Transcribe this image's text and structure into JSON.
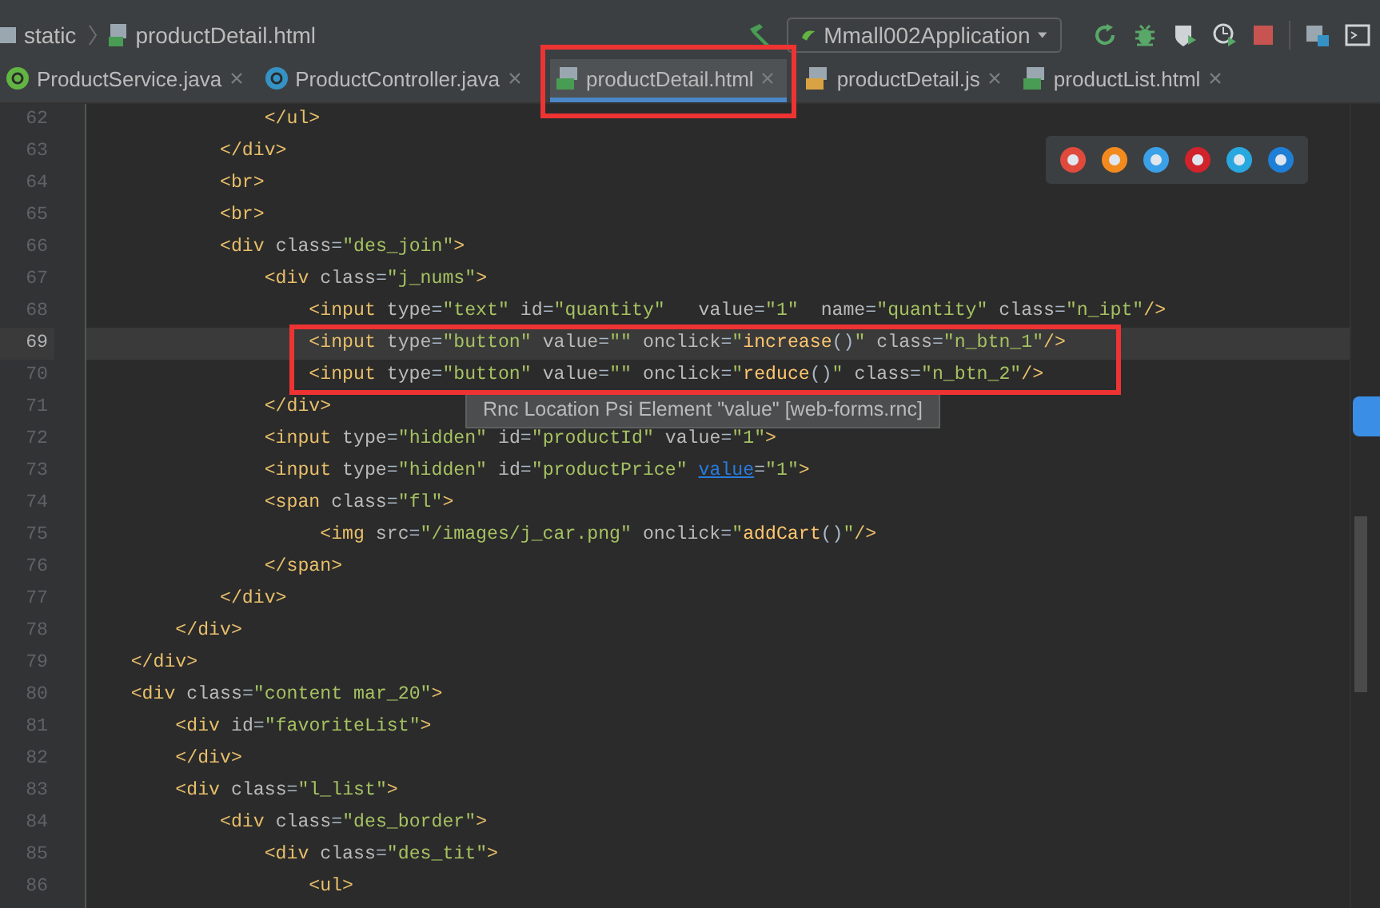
{
  "breadcrumb": [
    {
      "label": "static",
      "kind": "folder"
    },
    {
      "label": "productDetail.html",
      "kind": "html"
    }
  ],
  "run_configuration": {
    "label": "Mmall002Application"
  },
  "tabs": [
    {
      "label": "ProductService.java",
      "kind": "interface",
      "selected": false
    },
    {
      "label": "ProductController.java",
      "kind": "class",
      "selected": false
    },
    {
      "label": "productDetail.html",
      "kind": "html",
      "selected": true
    },
    {
      "label": "productDetail.js",
      "kind": "js",
      "selected": false
    },
    {
      "label": "productList.html",
      "kind": "html",
      "selected": false
    }
  ],
  "editor": {
    "lines": [
      {
        "number": "62",
        "current": false,
        "parts": [
          {
            "kind": "code",
            "text": "                </ul>"
          }
        ]
      },
      {
        "number": "63",
        "current": false,
        "parts": [
          {
            "kind": "code",
            "text": "            </div>"
          }
        ]
      },
      {
        "number": "64",
        "current": false,
        "parts": [
          {
            "kind": "code",
            "text": "            <br>"
          }
        ]
      },
      {
        "number": "65",
        "current": false,
        "parts": [
          {
            "kind": "code",
            "text": "            <br>"
          }
        ]
      },
      {
        "number": "66",
        "current": false,
        "parts": [
          {
            "kind": "code",
            "text": "            <div class=\"des_join\">"
          }
        ]
      },
      {
        "number": "67",
        "current": false,
        "parts": [
          {
            "kind": "code",
            "text": "                <div class=\"j_nums\">"
          }
        ]
      },
      {
        "number": "68",
        "current": false,
        "parts": [
          {
            "kind": "code",
            "text": "                    <input type=\"text\" id=\"quantity\"   value=\"1\"  name=\"quantity\" class=\"n_ipt\"/>"
          }
        ]
      },
      {
        "number": "69",
        "current": true,
        "parts": [
          {
            "kind": "code",
            "text": "                    <input type=\"button\" value=\"\" onclick=\"increase()\" class=\"n_btn_1\"/>"
          }
        ]
      },
      {
        "number": "70",
        "current": false,
        "parts": [
          {
            "kind": "code",
            "text": "                    <input type=\"button\" value=\"\" onclick=\"reduce()\" class=\"n_btn_2\"/>"
          }
        ]
      },
      {
        "number": "71",
        "current": false,
        "parts": [
          {
            "kind": "code",
            "text": "                </div>"
          }
        ]
      },
      {
        "number": "72",
        "current": false,
        "parts": [
          {
            "kind": "code",
            "text": "                <input type=\"hidden\" id=\"productId\" value=\"1\">"
          }
        ]
      },
      {
        "number": "73",
        "current": false,
        "parts": [
          {
            "kind": "code",
            "text": "                <input type=\"hidden\" id=\"productPrice\" "
          },
          {
            "kind": "link",
            "text": "value"
          },
          {
            "kind": "code",
            "text": "=\"1\">"
          }
        ]
      },
      {
        "number": "74",
        "current": false,
        "parts": [
          {
            "kind": "code",
            "text": "                <span class=\"fl\">"
          }
        ]
      },
      {
        "number": "75",
        "current": false,
        "parts": [
          {
            "kind": "code",
            "text": "                     <img src=\"/images/j_car.png\" onclick=\"addCart()\"/>"
          }
        ]
      },
      {
        "number": "76",
        "current": false,
        "parts": [
          {
            "kind": "code",
            "text": "                </span>"
          }
        ]
      },
      {
        "number": "77",
        "current": false,
        "parts": [
          {
            "kind": "code",
            "text": "            </div>"
          }
        ]
      },
      {
        "number": "78",
        "current": false,
        "parts": [
          {
            "kind": "code",
            "text": "        </div>"
          }
        ]
      },
      {
        "number": "79",
        "current": false,
        "parts": [
          {
            "kind": "code",
            "text": "    </div>"
          }
        ]
      },
      {
        "number": "80",
        "current": false,
        "parts": [
          {
            "kind": "code",
            "text": "    <div class=\"content mar_20\">"
          }
        ]
      },
      {
        "number": "81",
        "current": false,
        "parts": [
          {
            "kind": "code",
            "text": "        <div id=\"favoriteList\">"
          }
        ]
      },
      {
        "number": "82",
        "current": false,
        "parts": [
          {
            "kind": "code",
            "text": "        </div>"
          }
        ]
      },
      {
        "number": "83",
        "current": false,
        "parts": [
          {
            "kind": "code",
            "text": "        <div class=\"l_list\">"
          }
        ]
      },
      {
        "number": "84",
        "current": false,
        "parts": [
          {
            "kind": "code",
            "text": "            <div class=\"des_border\">"
          }
        ]
      },
      {
        "number": "85",
        "current": false,
        "parts": [
          {
            "kind": "code",
            "text": "                <div class=\"des_tit\">"
          }
        ]
      },
      {
        "number": "86",
        "current": false,
        "parts": [
          {
            "kind": "code",
            "text": "                    <ul>"
          }
        ]
      }
    ]
  },
  "tooltip": {
    "text": "Rnc Location Psi Element \"value\" [web-forms.rnc]"
  }
}
